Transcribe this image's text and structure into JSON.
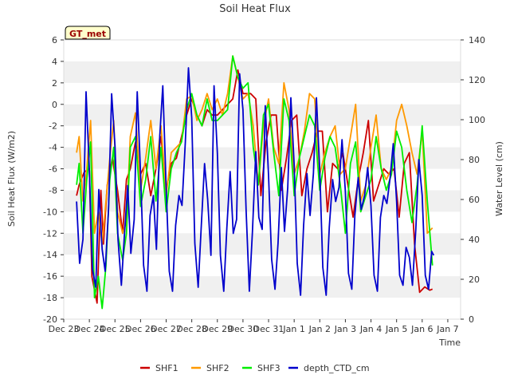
{
  "chart_data": {
    "type": "line",
    "title": "Soil Heat Flux",
    "xlabel": "Time",
    "ylabel": "Soil Heat Flux (W/m2)",
    "y2label": "Water Level (cm)",
    "badge": "GT_met",
    "ylim": [
      -20,
      6
    ],
    "y2lim": [
      0,
      140
    ],
    "xlim": [
      0,
      15.5
    ],
    "yticks": [
      -20,
      -18,
      -16,
      -14,
      -12,
      -10,
      -8,
      -6,
      -4,
      -2,
      0,
      2,
      4,
      6
    ],
    "y2ticks": [
      0,
      20,
      40,
      60,
      80,
      100,
      120,
      140
    ],
    "xticks": [
      {
        "x": 0,
        "label": "Dec 23"
      },
      {
        "x": 1,
        "label": "Dec 24"
      },
      {
        "x": 2,
        "label": "Dec 25"
      },
      {
        "x": 3,
        "label": "Dec 26"
      },
      {
        "x": 4,
        "label": "Dec 27"
      },
      {
        "x": 5,
        "label": "Dec 28"
      },
      {
        "x": 6,
        "label": "Dec 29"
      },
      {
        "x": 7,
        "label": "Dec 30"
      },
      {
        "x": 8,
        "label": "Dec 31"
      },
      {
        "x": 9,
        "label": "Jan 1"
      },
      {
        "x": 10,
        "label": "Jan 2"
      },
      {
        "x": 11,
        "label": "Jan 3"
      },
      {
        "x": 12,
        "label": "Jan 4"
      },
      {
        "x": 13,
        "label": "Jan 5"
      },
      {
        "x": 14,
        "label": "Jan 6"
      },
      {
        "x": 15,
        "label": "Jan 7"
      }
    ],
    "grid_bands": true,
    "legend_position": "bottom-center",
    "series": [
      {
        "name": "SHF1",
        "color": "#cc0000",
        "axis": "left",
        "x": [
          0.5,
          0.6,
          0.8,
          1.0,
          1.1,
          1.3,
          1.45,
          1.55,
          1.7,
          1.9,
          2.1,
          2.3,
          2.45,
          2.6,
          2.8,
          3.0,
          3.2,
          3.4,
          3.6,
          3.8,
          4.0,
          4.2,
          4.4,
          4.6,
          4.8,
          5.0,
          5.2,
          5.4,
          5.6,
          5.8,
          6.0,
          6.2,
          6.4,
          6.6,
          6.8,
          7.0,
          7.3,
          7.5,
          7.7,
          7.9,
          8.1,
          8.3,
          8.5,
          8.7,
          8.9,
          9.1,
          9.3,
          9.5,
          9.7,
          9.9,
          10.1,
          10.3,
          10.5,
          10.7,
          10.9,
          11.1,
          11.3,
          11.5,
          11.7,
          11.9,
          12.1,
          12.3,
          12.5,
          12.7,
          12.9,
          13.1,
          13.3,
          13.5,
          13.7,
          13.9,
          14.1,
          14.3,
          14.4
        ],
        "y": [
          -8.5,
          -7.5,
          -6.3,
          -6.0,
          -16.0,
          -18.5,
          -8.0,
          -13.0,
          -7.5,
          -5.0,
          -8.0,
          -12.0,
          -7.0,
          -6.0,
          -3.5,
          -6.5,
          -5.5,
          -8.5,
          -6.0,
          -3.0,
          -8.0,
          -5.5,
          -5.0,
          -3.0,
          -1.0,
          0.5,
          -1.0,
          -2.0,
          -0.5,
          -1.0,
          -1.0,
          -0.5,
          0.0,
          0.5,
          3.2,
          1.0,
          1.0,
          0.5,
          -8.5,
          -3.5,
          -1.0,
          -1.0,
          -8.0,
          -5.0,
          -1.5,
          -1.0,
          -8.5,
          -6.0,
          -4.5,
          -2.5,
          -2.5,
          -10.0,
          -5.5,
          -6.0,
          -4.5,
          -7.5,
          -10.5,
          -7.0,
          -4.5,
          -1.5,
          -9.0,
          -7.5,
          -6.0,
          -6.5,
          -6.0,
          -10.5,
          -5.5,
          -4.5,
          -13.0,
          -17.5,
          -17.0,
          -17.3,
          -17.2
        ]
      },
      {
        "name": "SHF2",
        "color": "#ff9900",
        "axis": "left",
        "x": [
          0.5,
          0.6,
          0.75,
          0.9,
          1.05,
          1.2,
          1.35,
          1.5,
          1.65,
          1.8,
          1.95,
          2.1,
          2.3,
          2.45,
          2.6,
          2.8,
          3.0,
          3.2,
          3.4,
          3.6,
          3.8,
          4.0,
          4.2,
          4.4,
          4.6,
          4.8,
          5.0,
          5.2,
          5.4,
          5.6,
          5.8,
          6.0,
          6.2,
          6.4,
          6.6,
          6.8,
          7.0,
          7.2,
          7.4,
          7.6,
          7.8,
          8.0,
          8.2,
          8.4,
          8.6,
          8.8,
          9.0,
          9.2,
          9.4,
          9.6,
          9.8,
          10.0,
          10.2,
          10.4,
          10.6,
          10.8,
          11.0,
          11.2,
          11.4,
          11.6,
          11.8,
          12.0,
          12.2,
          12.4,
          12.6,
          12.8,
          13.0,
          13.2,
          13.4,
          13.6,
          13.8,
          14.0,
          14.2,
          14.4
        ],
        "y": [
          -4.5,
          -3.0,
          -9.0,
          -6.0,
          -1.5,
          -12.0,
          -10.0,
          -13.0,
          -9.0,
          -5.0,
          -1.5,
          -10.0,
          -12.0,
          -11.0,
          -3.0,
          -0.8,
          -8.0,
          -5.0,
          -1.5,
          -6.0,
          -2.0,
          -8.5,
          -4.5,
          -4.0,
          -3.5,
          0.5,
          0.8,
          -1.5,
          -0.5,
          1.0,
          -0.5,
          0.5,
          -1.0,
          1.0,
          4.5,
          2.5,
          0.5,
          1.0,
          -2.0,
          -7.5,
          -2.0,
          0.5,
          -4.0,
          -5.5,
          2.0,
          -0.5,
          -6.5,
          -5.0,
          -2.5,
          1.0,
          0.5,
          -6.5,
          -4.5,
          -3.0,
          -2.0,
          -6.5,
          -6.0,
          -3.0,
          0.0,
          -9.0,
          -7.5,
          -4.0,
          -1.0,
          -6.0,
          -7.0,
          -6.0,
          -1.5,
          0.0,
          -2.0,
          -4.5,
          -6.5,
          -2.5,
          -12.0,
          -11.5
        ]
      },
      {
        "name": "SHF3",
        "color": "#00ee00",
        "axis": "left",
        "x": [
          0.5,
          0.6,
          0.75,
          0.9,
          1.05,
          1.2,
          1.35,
          1.5,
          1.65,
          1.8,
          1.95,
          2.1,
          2.3,
          2.45,
          2.6,
          2.8,
          3.0,
          3.2,
          3.4,
          3.6,
          3.8,
          4.0,
          4.2,
          4.4,
          4.6,
          4.8,
          5.0,
          5.2,
          5.4,
          5.6,
          5.8,
          6.0,
          6.2,
          6.4,
          6.6,
          6.8,
          7.0,
          7.2,
          7.4,
          7.6,
          7.8,
          8.0,
          8.2,
          8.4,
          8.6,
          8.8,
          9.0,
          9.2,
          9.4,
          9.6,
          9.8,
          10.0,
          10.2,
          10.4,
          10.6,
          10.8,
          11.0,
          11.2,
          11.4,
          11.6,
          11.8,
          12.0,
          12.2,
          12.4,
          12.6,
          12.8,
          13.0,
          13.2,
          13.4,
          13.6,
          13.8,
          14.0,
          14.2,
          14.4
        ],
        "y": [
          -7.5,
          -5.5,
          -12.0,
          -7.0,
          -3.5,
          -18.0,
          -16.0,
          -19.0,
          -15.0,
          -7.0,
          -4.0,
          -12.0,
          -14.5,
          -12.0,
          -4.0,
          -3.0,
          -9.5,
          -7.0,
          -3.0,
          -9.0,
          -4.0,
          -10.0,
          -6.0,
          -4.5,
          -3.5,
          -0.5,
          1.0,
          -1.0,
          -2.0,
          0.5,
          -1.5,
          -1.5,
          -1.0,
          -0.5,
          4.5,
          2.5,
          1.5,
          2.0,
          -4.0,
          -7.5,
          -1.0,
          0.0,
          -4.5,
          -8.5,
          0.5,
          -1.5,
          -8.5,
          -5.0,
          -3.0,
          -1.0,
          -2.0,
          -8.0,
          -5.0,
          -3.0,
          -4.0,
          -7.5,
          -12.0,
          -5.5,
          -3.5,
          -10.0,
          -8.5,
          -7.0,
          -3.0,
          -6.0,
          -8.0,
          -6.5,
          -2.5,
          -4.0,
          -8.0,
          -11.0,
          -7.5,
          -2.0,
          -9.0,
          -15.0
        ]
      },
      {
        "name": "depth_CTD_cm",
        "color": "#0000cc",
        "axis": "right",
        "x": [
          0.5,
          0.62,
          0.75,
          0.87,
          1.0,
          1.12,
          1.25,
          1.37,
          1.5,
          1.62,
          1.75,
          1.87,
          2.0,
          2.12,
          2.25,
          2.37,
          2.5,
          2.62,
          2.75,
          2.87,
          3.0,
          3.12,
          3.25,
          3.37,
          3.5,
          3.62,
          3.75,
          3.87,
          4.0,
          4.12,
          4.25,
          4.37,
          4.5,
          4.62,
          4.75,
          4.87,
          5.0,
          5.12,
          5.25,
          5.37,
          5.5,
          5.62,
          5.75,
          5.87,
          6.0,
          6.12,
          6.25,
          6.37,
          6.5,
          6.62,
          6.75,
          6.87,
          7.0,
          7.12,
          7.25,
          7.37,
          7.5,
          7.62,
          7.75,
          7.87,
          8.0,
          8.12,
          8.25,
          8.37,
          8.5,
          8.62,
          8.75,
          8.87,
          9.0,
          9.12,
          9.25,
          9.37,
          9.5,
          9.62,
          9.75,
          9.87,
          10.0,
          10.12,
          10.25,
          10.37,
          10.5,
          10.62,
          10.75,
          10.87,
          11.0,
          11.12,
          11.25,
          11.37,
          11.5,
          11.62,
          11.75,
          11.87,
          12.0,
          12.12,
          12.25,
          12.37,
          12.5,
          12.62,
          12.75,
          12.87,
          13.0,
          13.12,
          13.25,
          13.37,
          13.5,
          13.62,
          13.75,
          13.87,
          14.0,
          14.12,
          14.25,
          14.37,
          14.45
        ],
        "y": [
          59,
          28,
          40,
          114,
          75,
          25,
          16,
          65,
          35,
          24,
          55,
          113,
          87,
          40,
          17,
          42,
          67,
          33,
          50,
          114,
          73,
          27,
          14,
          52,
          62,
          35,
          92,
          117,
          66,
          24,
          14,
          47,
          62,
          57,
          89,
          126,
          101,
          38,
          16,
          46,
          78,
          60,
          32,
          117,
          83,
          32,
          14,
          46,
          74,
          43,
          50,
          123,
          105,
          55,
          14,
          44,
          84,
          51,
          45,
          107,
          72,
          30,
          15,
          38,
          76,
          44,
          66,
          111,
          77,
          28,
          12,
          47,
          73,
          52,
          73,
          111,
          74,
          26,
          12,
          46,
          70,
          59,
          66,
          90,
          64,
          23,
          15,
          52,
          71,
          55,
          62,
          76,
          57,
          22,
          14,
          51,
          62,
          58,
          71,
          88,
          59,
          22,
          17,
          36,
          31,
          17,
          45,
          80,
          62,
          22,
          15,
          34,
          32
        ]
      }
    ]
  }
}
